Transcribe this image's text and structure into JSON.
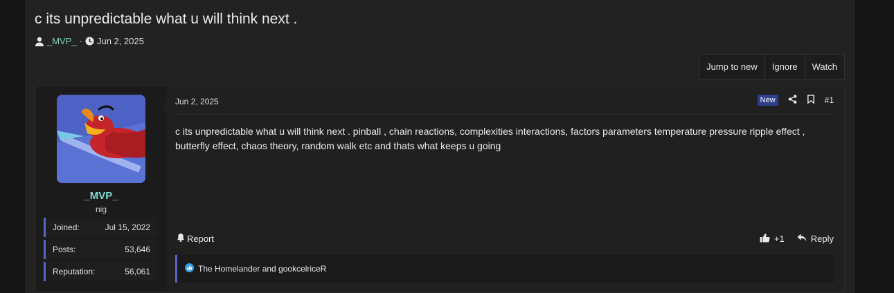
{
  "thread": {
    "title": "c its unpredictable what u will think next .",
    "author": "_MVP_",
    "separator": "·",
    "date": "Jun 2, 2025"
  },
  "buttons": {
    "jump_to_new": "Jump to new",
    "ignore": "Ignore",
    "watch": "Watch"
  },
  "post": {
    "user": {
      "name": "_MVP_",
      "title": "nig",
      "stats": [
        {
          "label": "Joined:",
          "value": "Jul 15, 2022"
        },
        {
          "label": "Posts:",
          "value": "53,646"
        },
        {
          "label": "Reputation:",
          "value": "56,061"
        }
      ]
    },
    "date": "Jun 2, 2025",
    "badge": "New",
    "number": "#1",
    "body": "c its unpredictable what u will think next . pinball , chain reactions, complexities interactions, factors parameters temperature pressure ripple effect , butterfly effect, chaos theory, random walk etc and thats what keeps u going",
    "report": "Report",
    "like_count": "+1",
    "reply": "Reply",
    "reactions_text": "The Homelander and gookcelriceR"
  },
  "icons": [
    "user-icon",
    "clock-icon",
    "share-icon",
    "bookmark-icon",
    "bell-icon",
    "thumbs-up-icon",
    "reply-icon",
    "like-reaction-icon"
  ],
  "colors": {
    "accent": "#5b63c7",
    "username": "#7fe0cf",
    "badge": "#2f3d8a"
  }
}
